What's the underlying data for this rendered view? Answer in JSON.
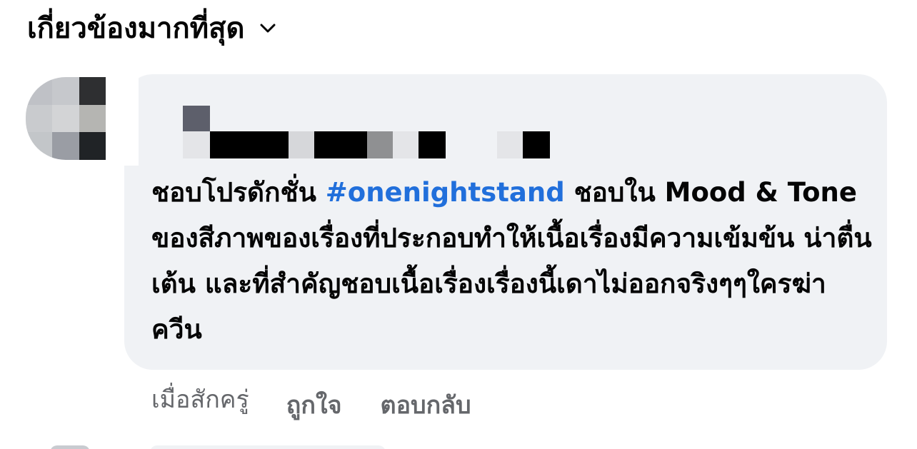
{
  "sort": {
    "label": "เกี่ยวข้องมากที่สุด",
    "icon": "chevron-down-icon"
  },
  "comment": {
    "text_before": "ชอบโปรดักชั่น ",
    "hashtag": "#onenightstand",
    "text_after": " ชอบใน Mood & Tone ของสีภาพของเรื่องที่ประกอบทำให้เนื้อเรื่องมีความเข้มข้น น่าตื่นเต้น และที่สำคัญชอบเนื้อเรื่องเรื่องนี้เดาไม่ออกจริงๆๆใครฆ่าควีน",
    "time": "เมื่อสักครู่",
    "like_label": "ถูกใจ",
    "reply_label": "ตอบกลับ"
  },
  "colors": {
    "bubble_bg": "#f0f2f5",
    "text": "#050505",
    "hashtag": "#216fdb",
    "meta": "#65676b"
  }
}
